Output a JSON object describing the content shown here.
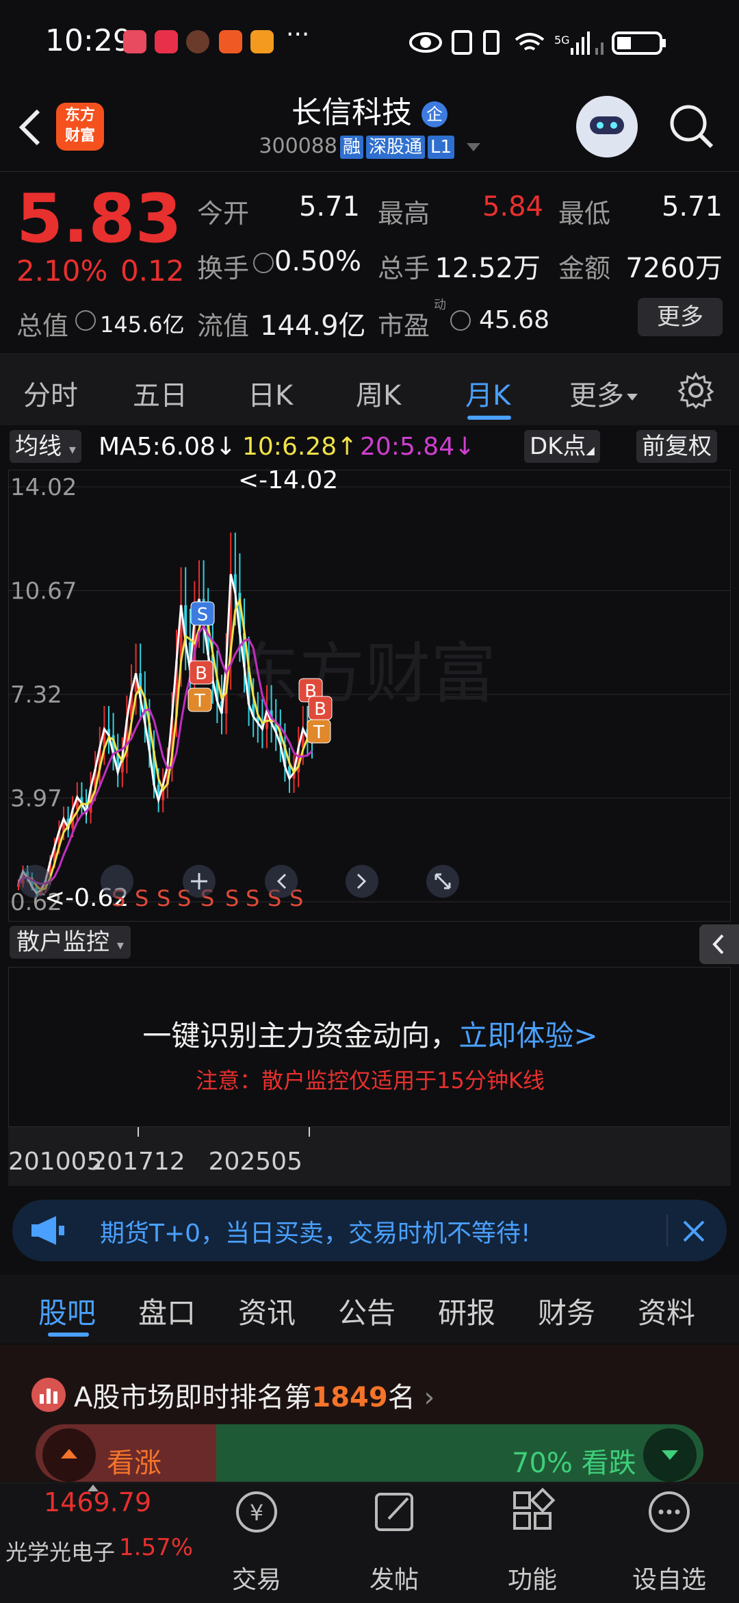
{
  "status_bar": {
    "time": "10:29",
    "more": "···"
  },
  "header": {
    "logo_line1": "东方",
    "logo_line2": "财富",
    "stock_name": "长信科技",
    "badge": "企",
    "code": "300088",
    "tags": [
      "融",
      "深股通",
      "L1"
    ]
  },
  "quote": {
    "price": "5.83",
    "change_pct": "2.10%",
    "change": "0.12",
    "open_label": "今开",
    "open": "5.71",
    "high_label": "最高",
    "high": "5.84",
    "low_label": "最低",
    "low": "5.71",
    "turnover_label": "换手",
    "turnover": "0.50%",
    "volume_label": "总手",
    "volume": "12.52万",
    "amount_label": "金额",
    "amount": "7260万",
    "mcap_label": "总值",
    "mcap": "145.6亿",
    "float_label": "流值",
    "float": "144.9亿",
    "pe_label": "市盈",
    "pe_sup": "动",
    "pe": "45.68",
    "more_label": "更多"
  },
  "tabs": {
    "items": [
      "分时",
      "五日",
      "日K",
      "周K",
      "月K",
      "更多"
    ],
    "active": "月K"
  },
  "chart_toolbar": {
    "ma_selector": "均线",
    "ma5": "MA5:6.08↓",
    "ma10": "10:6.28↑",
    "ma20": "20:5.84↓",
    "dk_label": "DK点",
    "adjust_label": "前复权"
  },
  "chart_data": {
    "type": "candlestick",
    "y_ticks": [
      "14.02",
      "10.67",
      "7.32",
      "3.97",
      "0.62"
    ],
    "ylim": [
      0.62,
      14.02
    ],
    "max_marker": "<-14.02",
    "min_marker": "<-0.62",
    "x_ticks": [
      "201005",
      "201712",
      "202505"
    ],
    "watermark": "东方财富",
    "signal_labels": [
      "S",
      "B",
      "T"
    ],
    "close_series": [
      1.2,
      1.6,
      1.4,
      1.1,
      0.9,
      1.0,
      1.3,
      1.9,
      2.4,
      2.9,
      3.3,
      3.0,
      3.6,
      4.0,
      3.8,
      3.5,
      4.3,
      4.9,
      5.6,
      6.2,
      6.0,
      5.4,
      4.8,
      5.3,
      6.5,
      7.4,
      8.0,
      7.2,
      6.4,
      5.5,
      4.4,
      3.9,
      4.4,
      5.0,
      6.6,
      8.4,
      10.2,
      9.0,
      8.1,
      9.8,
      10.4,
      9.6,
      8.6,
      7.8,
      7.1,
      6.7,
      8.3,
      11.2,
      10.6,
      9.3,
      8.2,
      7.0,
      6.6,
      6.4,
      6.2,
      6.8,
      6.4,
      6.1,
      5.7,
      5.0,
      4.6,
      4.8,
      5.6,
      6.2,
      5.9,
      5.83
    ]
  },
  "sanhu": {
    "selector": "散户监控",
    "headline": "一键识别主力资金动向，",
    "cta": "立即体验>",
    "note": "注意：散户监控仅适用于15分钟K线"
  },
  "banner": {
    "text": "期货T+0，当日买卖，交易时机不等待!"
  },
  "bottom_tabs": {
    "items": [
      "股吧",
      "盘口",
      "资讯",
      "公告",
      "研报",
      "财务",
      "资料"
    ],
    "active": "股吧"
  },
  "rank": {
    "prefix": "A股市场即时排名第",
    "number": "1849",
    "suffix": "名"
  },
  "vote": {
    "up_label": "看涨",
    "down_label": "70% 看跌",
    "down_pct": 70
  },
  "nav": {
    "index_value": "1469.79",
    "index_name": "光学光电子",
    "index_change": "1.57%",
    "items": [
      "交易",
      "发帖",
      "功能",
      "设自选"
    ]
  },
  "colors": {
    "up": "#e8302e",
    "down": "#2ecf78",
    "accent": "#4aa0ff",
    "ma5": "#ffffff",
    "ma10": "#f2e24a",
    "ma20": "#c02fc0"
  }
}
